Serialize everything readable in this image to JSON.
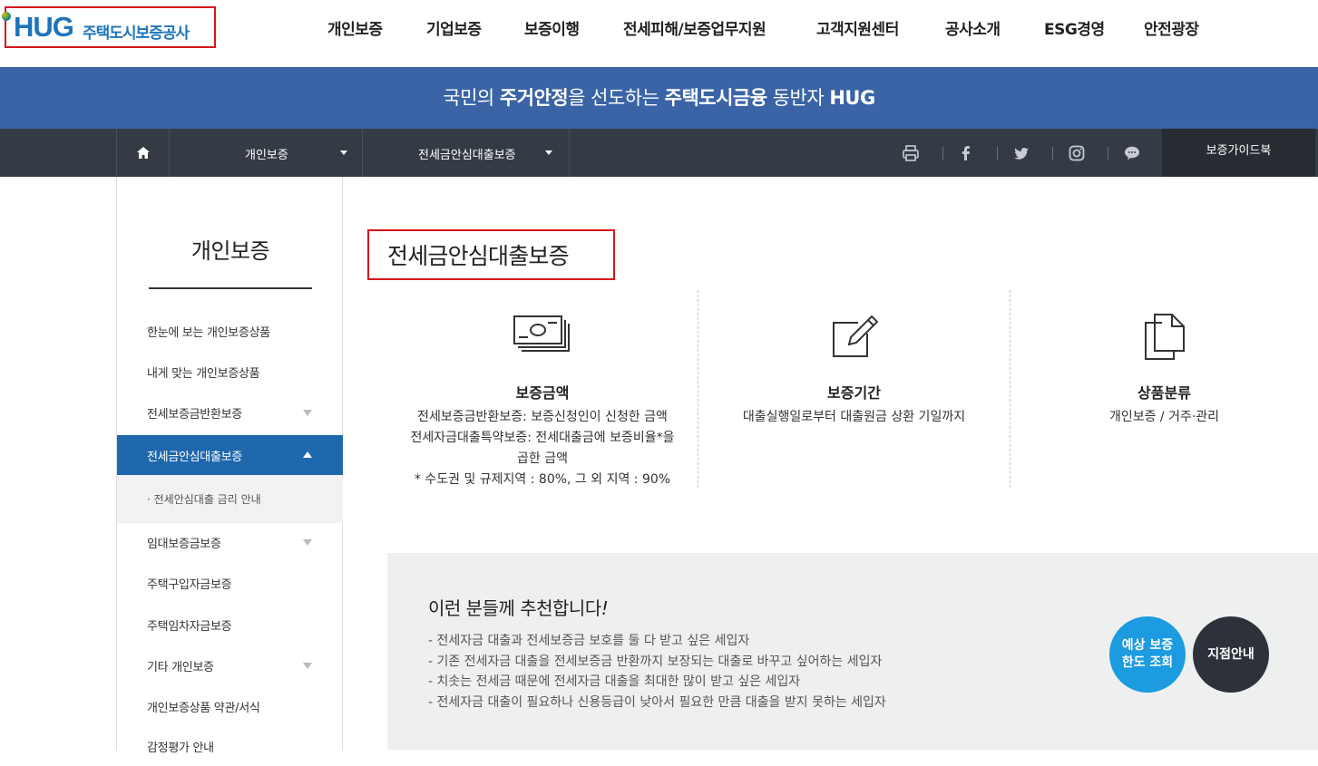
{
  "header": {
    "logo_text": "HUG",
    "logo_korean": "주택도시보증공사",
    "nav": [
      "개인보증",
      "기업보증",
      "보증이행",
      "전세피해/보증업무지원",
      "고객지원센터",
      "공사소개",
      "ESG경영",
      "안전광장"
    ]
  },
  "banner": {
    "part1": "국민의 ",
    "bold1": "주거안정",
    "part2": "을 선도하는 ",
    "bold2": "주택도시금융",
    "part3": " 동반자 ",
    "bold3": "HUG"
  },
  "subnav": {
    "home_icon": "home-icon",
    "crumb1": "개인보증",
    "crumb2": "전세금안심대출보증",
    "sns": [
      "print-icon",
      "facebook-icon",
      "twitter-icon",
      "instagram-icon",
      "talk-icon"
    ],
    "guide_button": "보증가이드북"
  },
  "sidebar": {
    "title": "개인보증",
    "items": [
      {
        "label": "한눈에 보는 개인보증상품",
        "arrow": false
      },
      {
        "label": "내게 맞는 개인보증상품",
        "arrow": false
      },
      {
        "label": "전세보증금반환보증",
        "arrow": true
      },
      {
        "label": "전세금안심대출보증",
        "arrow": true,
        "active": true
      },
      {
        "label": "임대보증금보증",
        "arrow": true
      },
      {
        "label": "주택구입자금보증",
        "arrow": false
      },
      {
        "label": "주택임차자금보증",
        "arrow": false
      },
      {
        "label": "기타 개인보증",
        "arrow": true
      },
      {
        "label": "개인보증상품 약관/서식",
        "arrow": false
      },
      {
        "label": "감정평가 안내",
        "arrow": false
      }
    ],
    "sub_item": "· 전세안심대출 금리 안내"
  },
  "main": {
    "title": "전세금안심대출보증",
    "info": [
      {
        "icon": "money-icon",
        "heading": "보증금액",
        "lines": [
          "전세보증금반환보증: 보증신청인이 신청한 금액",
          "전세자금대출특약보증: 전세대출금에 보증비율*을",
          "곱한 금액",
          "* 수도권 및 규제지역 : 80%, 그 외 지역 : 90%"
        ]
      },
      {
        "icon": "edit-icon",
        "heading": "보증기간",
        "lines": [
          "대출실행일로부터 대출원금 상환 기일까지"
        ]
      },
      {
        "icon": "document-icon",
        "heading": "상품분류",
        "lines": [
          "개인보증 / 거주·관리"
        ]
      }
    ],
    "recommend": {
      "title": "이런 분들께 추천합니다",
      "title_mark": "!",
      "items": [
        "- 전세자금 대출과 전세보증금 보호를 둘 다 받고 싶은 세입자",
        "- 기존 전세자금 대출을 전세보증금 반환까지 보장되는 대출로 바꾸고 싶어하는 세입자",
        "- 치솟는 전세금 때문에 전세자금 대출을 최대한 많이 받고 싶은 세입자",
        "- 전세자금 대출이 필요하나 신용등급이 낮아서 필요한 만큼 대출을 받지 못하는 세입자"
      ],
      "btn_limit_line1": "예상 보증",
      "btn_limit_line2": "한도 조회",
      "btn_branch": "지점안내"
    }
  },
  "colors": {
    "brand_blue": "#1d74bb",
    "banner": "#3a64a6",
    "subnav": "#353b44",
    "active": "#1f68ad",
    "highlight_red": "#d7151b"
  }
}
